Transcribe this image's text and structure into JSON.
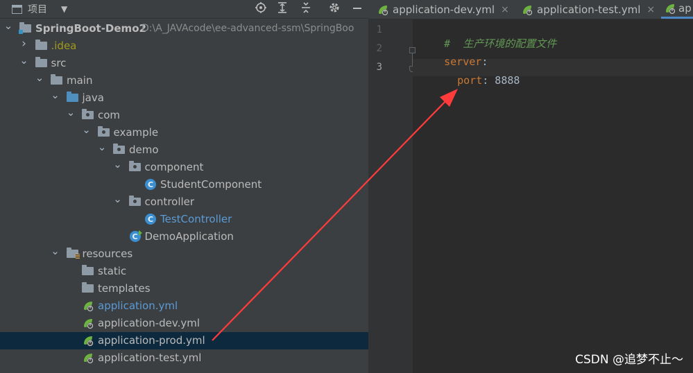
{
  "project_panel": {
    "title": "项目",
    "tool_icons": [
      "locate-icon",
      "expand-all-icon",
      "collapse-all-icon",
      "gear-icon",
      "minimize-icon"
    ],
    "tree": [
      {
        "label": "SpringBoot-Demo2",
        "path": "D:\\A_JAVAcode\\ee-advanced-ssm\\SpringBoo",
        "icon": "module-folder-icon",
        "expanded": true,
        "depth": 0
      },
      {
        "label": ".idea",
        "icon": "folder-icon",
        "expanded": false,
        "depth": 1,
        "color": "olive"
      },
      {
        "label": "src",
        "icon": "folder-icon",
        "expanded": true,
        "depth": 1
      },
      {
        "label": "main",
        "icon": "folder-icon",
        "expanded": true,
        "depth": 2
      },
      {
        "label": "java",
        "icon": "source-folder-icon",
        "expanded": true,
        "depth": 3
      },
      {
        "label": "com",
        "icon": "package-icon",
        "expanded": true,
        "depth": 4
      },
      {
        "label": "example",
        "icon": "package-icon",
        "expanded": true,
        "depth": 5
      },
      {
        "label": "demo",
        "icon": "package-icon",
        "expanded": true,
        "depth": 6
      },
      {
        "label": "component",
        "icon": "package-icon",
        "expanded": true,
        "depth": 7
      },
      {
        "label": "StudentComponent",
        "icon": "class-icon",
        "depth": 8
      },
      {
        "label": "controller",
        "icon": "package-icon",
        "expanded": true,
        "depth": 7
      },
      {
        "label": "TestController",
        "icon": "class-icon",
        "depth": 8,
        "color": "blue"
      },
      {
        "label": "DemoApplication",
        "icon": "spring-boot-class-icon",
        "depth": 7
      },
      {
        "label": "resources",
        "icon": "resources-folder-icon",
        "expanded": true,
        "depth": 3
      },
      {
        "label": "static",
        "icon": "folder-icon",
        "depth": 4
      },
      {
        "label": "templates",
        "icon": "folder-icon",
        "depth": 4
      },
      {
        "label": "application.yml",
        "icon": "spring-yml-icon",
        "depth": 4,
        "color": "blue"
      },
      {
        "label": "application-dev.yml",
        "icon": "spring-yml-icon",
        "depth": 4
      },
      {
        "label": "application-prod.yml",
        "icon": "spring-yml-icon",
        "depth": 4,
        "selected": true
      },
      {
        "label": "application-test.yml",
        "icon": "spring-yml-icon",
        "depth": 4
      }
    ]
  },
  "editor": {
    "tabs": [
      {
        "label": "application-dev.yml",
        "icon": "spring-yml-icon",
        "close": "×"
      },
      {
        "label": "application-test.yml",
        "icon": "spring-yml-icon",
        "close": "×"
      },
      {
        "label": "ap",
        "icon": "spring-yml-icon",
        "active": true
      }
    ],
    "line_numbers": [
      "1",
      "2",
      "3"
    ],
    "code": {
      "line1_comment": "#  生产环境的配置文件",
      "line2_key": "server",
      "line2_colon": ":",
      "line3_key": "port",
      "line3_colon": ":",
      "line3_value": " 8888"
    }
  },
  "watermark": "CSDN @追梦不止～",
  "colors": {
    "annotation_arrow": "#ff3b3b",
    "selection": "#0d293e",
    "accent": "#4a88c7"
  }
}
